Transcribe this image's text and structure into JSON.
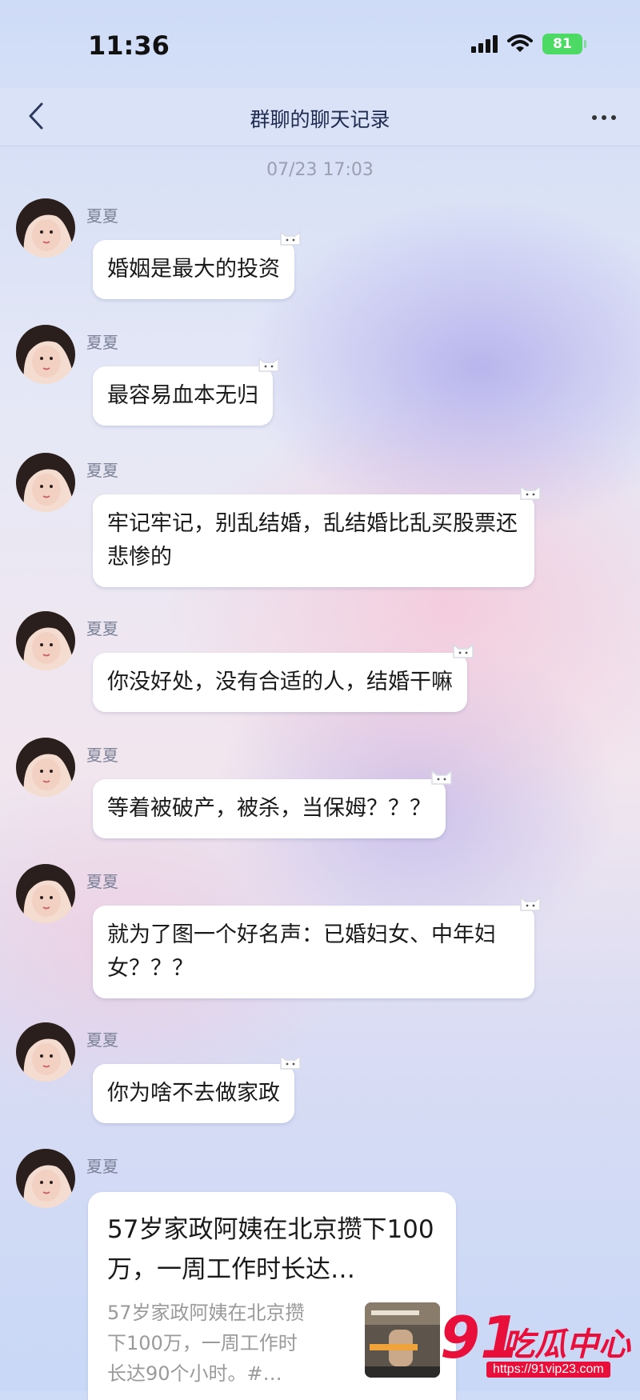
{
  "status_bar": {
    "time": "11:36",
    "battery": "81"
  },
  "nav": {
    "title": "群聊的聊天记录"
  },
  "timestamp": "07/23 17:03",
  "messages": [
    {
      "sender": "夏夏",
      "text": "婚姻是最大的投资"
    },
    {
      "sender": "夏夏",
      "text": "最容易血本无归"
    },
    {
      "sender": "夏夏",
      "text": "牢记牢记，别乱结婚，乱结婚比乱买股票还悲惨的"
    },
    {
      "sender": "夏夏",
      "text": "你没好处，没有合适的人，结婚干嘛"
    },
    {
      "sender": "夏夏",
      "text": "等着被破产，被杀，当保姆？？？"
    },
    {
      "sender": "夏夏",
      "text": "就为了图一个好名声：已婚妇女、中年妇女？？？"
    },
    {
      "sender": "夏夏",
      "text": "你为啥不去做家政"
    },
    {
      "sender": "夏夏"
    }
  ],
  "link_card": {
    "title": "57岁家政阿姨在北京攒下100万，一周工作时长达…",
    "description": "57岁家政阿姨在北京攒下100万，一周工作时长达90个小时。#…"
  },
  "watermark": {
    "number": "91",
    "text": "吃瓜中心",
    "url": "https://91vip23.com"
  },
  "colors": {
    "accent": "#e8103a",
    "battery": "#4cd964",
    "bubble": "#ffffff"
  }
}
